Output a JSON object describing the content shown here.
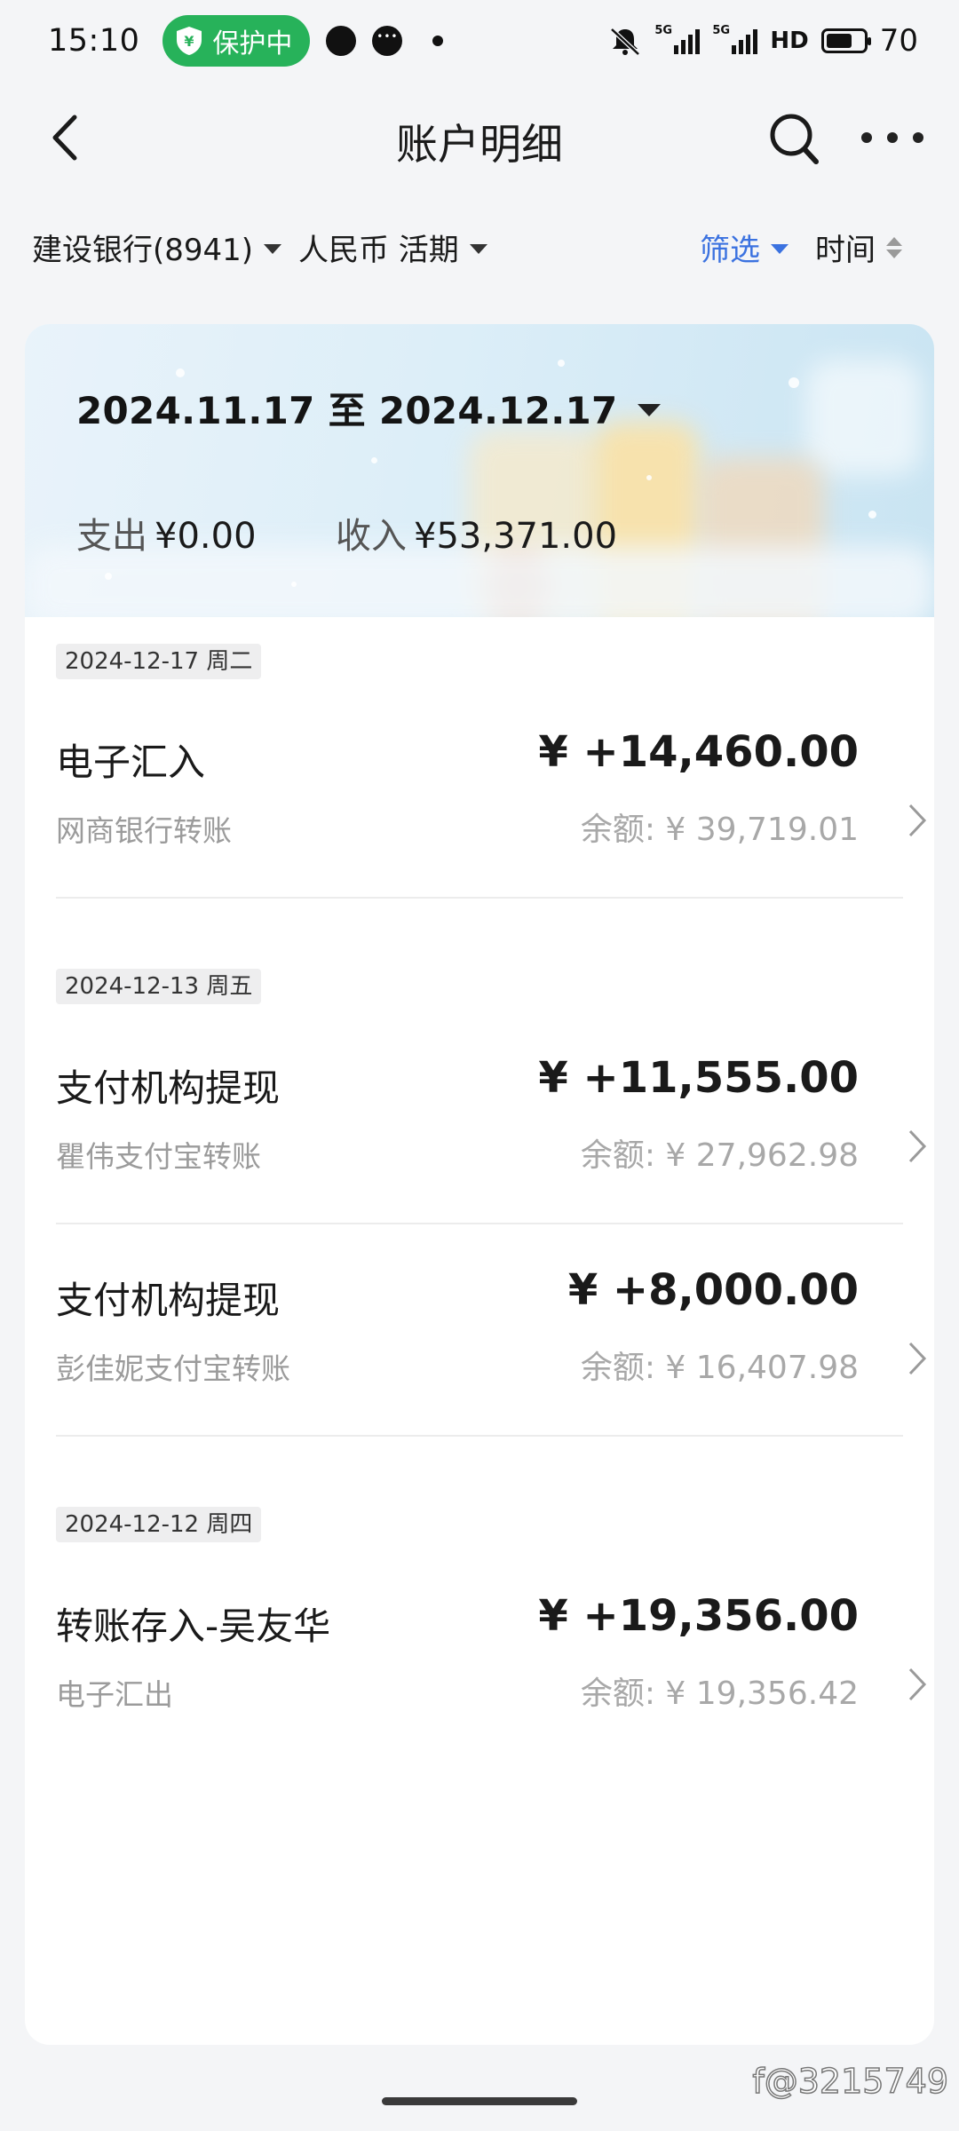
{
  "status_bar": {
    "time": "15:10",
    "protect_label": "保护中",
    "network_tag_1": "5G",
    "network_tag_2": "5G",
    "hd_label": "HD",
    "battery_level": "70",
    "battery_fraction": 0.7
  },
  "nav": {
    "title": "账户明细",
    "back_icon": "back-arrow-icon",
    "search_icon": "search-icon",
    "more_icon": "more-dots-icon"
  },
  "filters": {
    "account": "建设银行(8941)",
    "currency": "人民币 活期",
    "filter_label": "筛选",
    "sort_label": "时间",
    "accent_color": "#3b72e0"
  },
  "summary": {
    "date_range": "2024.11.17 至 2024.12.17",
    "expense_label": "支出",
    "expense_value": "¥0.00",
    "income_label": "收入",
    "income_value": "¥53,371.00"
  },
  "groups": [
    {
      "date": "2024-12-17 周二",
      "transactions": [
        {
          "title": "电子汇入",
          "subtitle": "网商银行转账",
          "amount": "¥ +14,460.00",
          "balance": "余额: ¥ 39,719.01"
        }
      ]
    },
    {
      "date": "2024-12-13 周五",
      "transactions": [
        {
          "title": "支付机构提现",
          "subtitle": "瞿伟支付宝转账",
          "amount": "¥ +11,555.00",
          "balance": "余额: ¥ 27,962.98"
        },
        {
          "title": "支付机构提现",
          "subtitle": "彭佳妮支付宝转账",
          "amount": "¥ +8,000.00",
          "balance": "余额: ¥ 16,407.98"
        }
      ]
    },
    {
      "date": "2024-12-12 周四",
      "transactions": [
        {
          "title": "转账存入-吴友华",
          "subtitle": "电子汇出",
          "amount": "¥ +19,356.00",
          "balance": "余额: ¥ 19,356.42"
        }
      ]
    }
  ],
  "watermark": "f@3215749"
}
